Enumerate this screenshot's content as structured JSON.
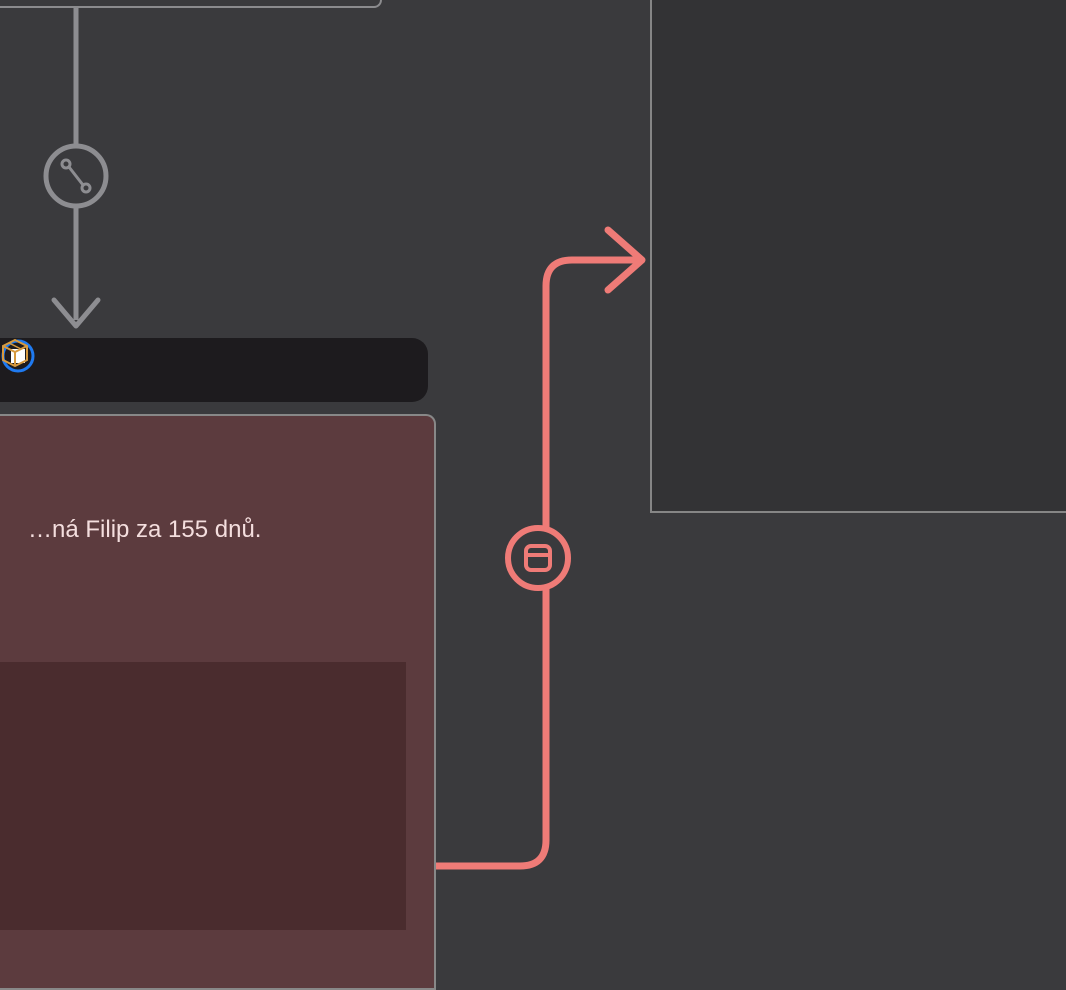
{
  "node": {
    "text": "…ná Filip za 155 dnů."
  },
  "icons": {
    "merge": "merge-icon",
    "stop": "stop-icon",
    "box": "box-icon",
    "window": "window-icon"
  },
  "colors": {
    "connector_red": "#ef7b77",
    "connector_gray": "#8d8d91",
    "toolbar_bg": "#1d1b1e",
    "node_bg": "#5c3b3e",
    "inner_bg": "#4a2c2e",
    "canvas_bg": "#3a3a3d",
    "accent_orange": "#d79a3f",
    "accent_blue": "#1f7af0"
  }
}
